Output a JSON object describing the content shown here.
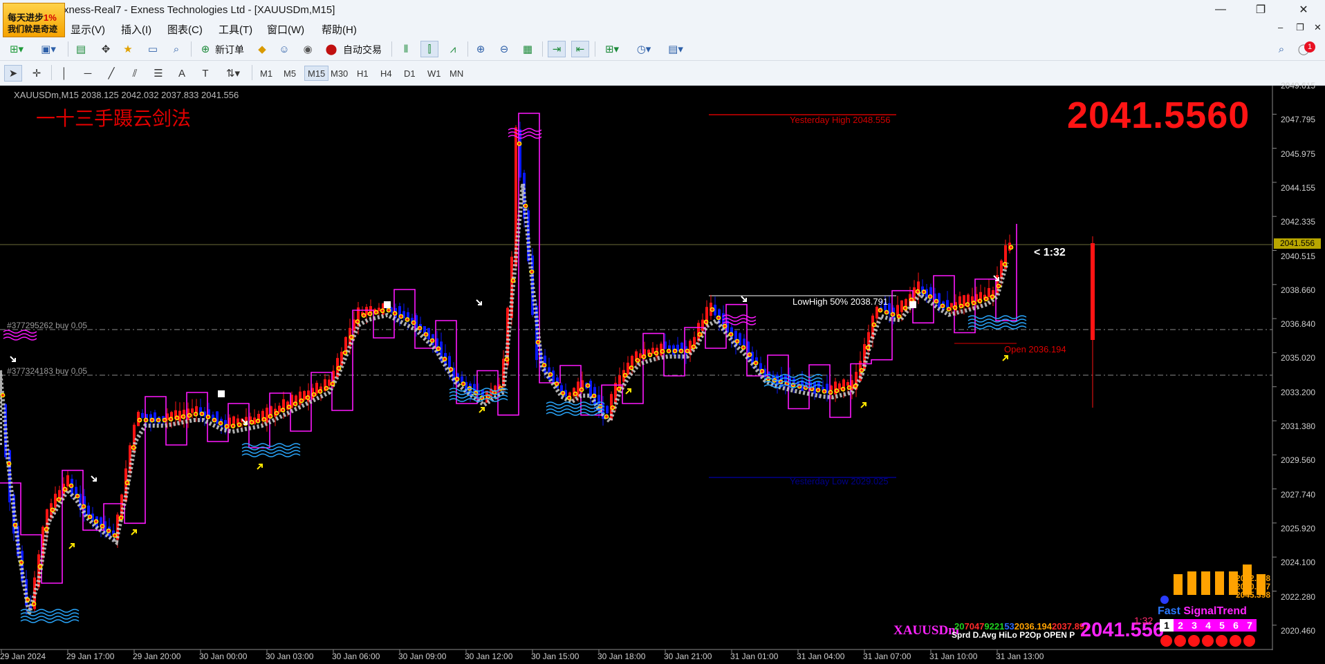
{
  "window": {
    "title": "xness-Real7 - Exness Technologies Ltd - [XAUUSDm,M15]",
    "logo_line1": "每天进步",
    "logo_percent": "1%",
    "logo_line2": "我们就是奇迹",
    "minimize_glyph": "—",
    "restore_glyph": "❐",
    "close_glyph": "✕"
  },
  "menu": {
    "items": [
      "显示(V)",
      "插入(I)",
      "图表(C)",
      "工具(T)",
      "窗口(W)",
      "帮助(H)"
    ],
    "mdi_min": "–",
    "mdi_restore": "❐",
    "mdi_close": "✕"
  },
  "toolbar1": {
    "new_order": "新订单",
    "auto_trading": "自动交易",
    "notification_count": "1"
  },
  "toolbar2": {
    "timeframes": [
      "M1",
      "M5",
      "M15",
      "M30",
      "H1",
      "H4",
      "D1",
      "W1",
      "MN"
    ],
    "active_timeframe": "M15"
  },
  "chart": {
    "symbol_info": "XAUUSDm,M15  2038.125 2042.032 2037.833 2041.556",
    "strategy_label": "一十三手蹑云剑法",
    "big_price": "2041.5560",
    "candle_timer": "< 1:32",
    "yesterday_high": "Yesterday High  2048.556",
    "yesterday_low": "Yesterday Low  2029.025",
    "lowhigh": "LowHigh 50%  2038.791",
    "open_label": "Open  2036.194",
    "order1": "#377295262 buy 0.05",
    "order2": "#377324183 buy 0.05",
    "current_price": "2041.556",
    "price_axis": [
      "2049.615",
      "2047.795",
      "2045.975",
      "2044.155",
      "2042.335",
      "2040.515",
      "2038.660",
      "2036.840",
      "2035.020",
      "2033.200",
      "2031.380",
      "2029.560",
      "2027.740",
      "2025.920",
      "2024.100",
      "2022.280",
      "2020.460"
    ],
    "time_axis": [
      "29 Jan 2024",
      "29 Jan 17:00",
      "29 Jan 20:00",
      "30 Jan 00:00",
      "30 Jan 03:00",
      "30 Jan 06:00",
      "30 Jan 09:00",
      "30 Jan 12:00",
      "30 Jan 15:00",
      "30 Jan 18:00",
      "30 Jan 21:00",
      "31 Jan 01:00",
      "31 Jan 04:00",
      "31 Jan 07:00",
      "31 Jan 10:00",
      "31 Jan 13:00"
    ],
    "colors": {
      "bull": "#ff1414",
      "bear": "#0a18ff",
      "magenta": "#ff18ff",
      "yellow": "#ffe600",
      "white": "#ffffff"
    }
  },
  "panel": {
    "symbol": "XAUUSDm",
    "num1": "20",
    "num2": "70",
    "num3": "47",
    "num4": "9221",
    "num5": "53",
    "num6": "2036.194",
    "num7": "2037.897",
    "labels": "Sprd D.Avg  HiLo P2Op     OPEN     P",
    "big_price": "2041.556",
    "signal_timer": "1:32",
    "fast_label": "Fast ",
    "signal_label": "SignalTrend",
    "levels": [
      "2062.078",
      "2050.007",
      "2045.398"
    ],
    "cells": [
      "1",
      "2",
      "3",
      "4",
      "5",
      "6",
      "7"
    ]
  }
}
